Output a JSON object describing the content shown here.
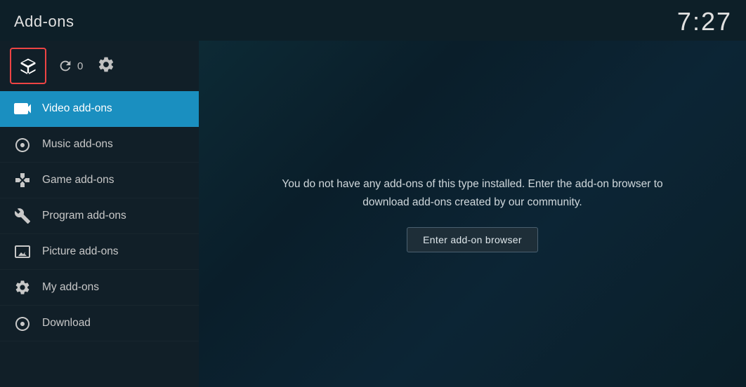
{
  "header": {
    "title": "Add-ons",
    "time": "7:27"
  },
  "toolbar": {
    "refresh_count": "0"
  },
  "sidebar": {
    "items": [
      {
        "id": "video-addons",
        "label": "Video add-ons",
        "active": true
      },
      {
        "id": "music-addons",
        "label": "Music add-ons",
        "active": false
      },
      {
        "id": "game-addons",
        "label": "Game add-ons",
        "active": false
      },
      {
        "id": "program-addons",
        "label": "Program add-ons",
        "active": false
      },
      {
        "id": "picture-addons",
        "label": "Picture add-ons",
        "active": false
      },
      {
        "id": "my-addons",
        "label": "My add-ons",
        "active": false
      },
      {
        "id": "download",
        "label": "Download",
        "active": false
      }
    ]
  },
  "content": {
    "empty_message": "You do not have any add-ons of this type installed. Enter the add-on browser to download add-ons created by our community.",
    "browser_button_label": "Enter add-on browser"
  }
}
